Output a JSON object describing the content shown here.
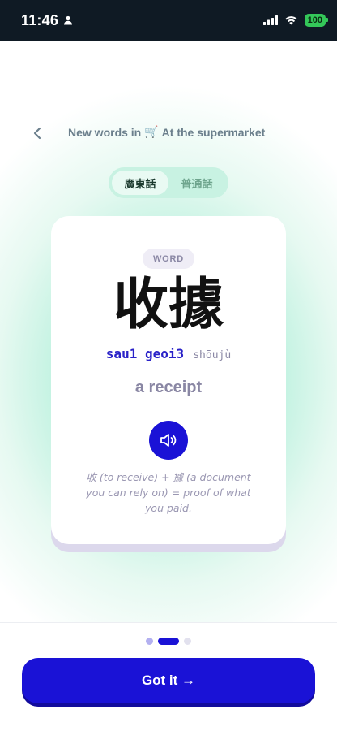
{
  "status_bar": {
    "time": "11:46",
    "battery": "100"
  },
  "header": {
    "title_prefix": "New words in",
    "title_emoji": "🛒",
    "title_suffix": "At the supermarket"
  },
  "language_toggle": {
    "options": [
      {
        "label": "廣東話",
        "active": true
      },
      {
        "label": "普通話",
        "active": false
      }
    ]
  },
  "card": {
    "badge": "WORD",
    "hanzi": "收據",
    "jyutping": "sau1 geoi3",
    "pinyin": "shōujù",
    "meaning": "a receipt",
    "etymology": "收 (to receive) + 據 (a document you can rely on) = proof of what you paid."
  },
  "pager": {
    "total": 3,
    "current": 2
  },
  "cta": {
    "label": "Got it →"
  },
  "colors": {
    "accent": "#1a12d6",
    "jyutping": "#2a22c8",
    "muted": "#8a87a4",
    "mint": "#b6f0dc"
  },
  "icons": {
    "back": "chevron-left-icon",
    "audio": "speaker-icon",
    "person": "person-icon",
    "signal": "cellular-signal-icon",
    "wifi": "wifi-icon",
    "battery": "battery-icon"
  }
}
